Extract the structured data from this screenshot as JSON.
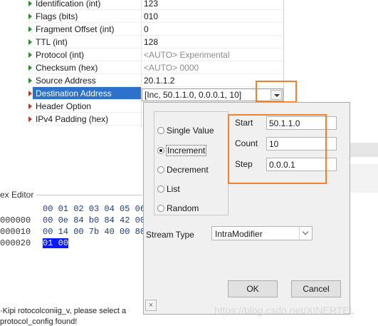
{
  "fields": [
    {
      "name": "Identification  (int)",
      "value": "123",
      "value_style": "normal",
      "arrow": "green"
    },
    {
      "name": "Flags (bits)",
      "value": "010",
      "value_style": "normal",
      "arrow": "green"
    },
    {
      "name": "Fragment Offset (int)",
      "value": "0",
      "value_style": "normal",
      "arrow": "green"
    },
    {
      "name": "TTL (int)",
      "value": "128",
      "value_style": "normal",
      "arrow": "green"
    },
    {
      "name": "Protocol (int)",
      "value": "<AUTO> Experimental",
      "value_style": "auto",
      "arrow": "green"
    },
    {
      "name": "Checksum (hex)",
      "value": "<AUTO> 0000",
      "value_style": "auto",
      "arrow": "green"
    },
    {
      "name": "Source Address",
      "value": "20.1.1.2",
      "value_style": "normal",
      "arrow": "green"
    },
    {
      "name": "Destination Address",
      "value": "[Inc, 50.1.1.0, 0.0.0.1, 10]",
      "value_style": "combo",
      "arrow": "red",
      "selected": true
    },
    {
      "name": "Header Option",
      "value": "",
      "value_style": "normal",
      "arrow": "red"
    },
    {
      "name": "IPv4 Padding (hex)",
      "value": "",
      "value_style": "normal",
      "arrow": "red"
    }
  ],
  "hex_editor": {
    "title": "ex Editor",
    "header": "00 01 02 03 04 05 06",
    "rows": [
      {
        "addr": "000000",
        "bytes": "00 0e 84 b0 84 42 00"
      },
      {
        "addr": "000010",
        "bytes": "00 14 00 7b 40 00 80"
      },
      {
        "addr": "000020",
        "bytes": "",
        "selected_bytes": "01 00"
      }
    ]
  },
  "status": {
    "line1": "·Kipi rotocolconiig_v, please select a",
    "line2": "protocol_config found!"
  },
  "dialog": {
    "modes": [
      {
        "label": "Single Value",
        "checked": false
      },
      {
        "label": "Increment",
        "checked": true
      },
      {
        "label": "Decrement",
        "checked": false
      },
      {
        "label": "List",
        "checked": false
      },
      {
        "label": "Random",
        "checked": false
      }
    ],
    "params": {
      "start_label": "Start",
      "start_value": "50.1.1.0",
      "count_label": "Count",
      "count_value": "10",
      "step_label": "Step",
      "step_value": "0.0.0.1"
    },
    "stream_type_label": "Stream Type",
    "stream_type_value": "IntraModifier",
    "ok_label": "OK",
    "cancel_label": "Cancel",
    "close_glyph": "×"
  },
  "watermark": "https://blog.csdn.net/XINERTEL",
  "colors": {
    "selection": "#2f71c9",
    "highlight_box": "#f0812c",
    "hex_selection": "#0a1bf5"
  }
}
